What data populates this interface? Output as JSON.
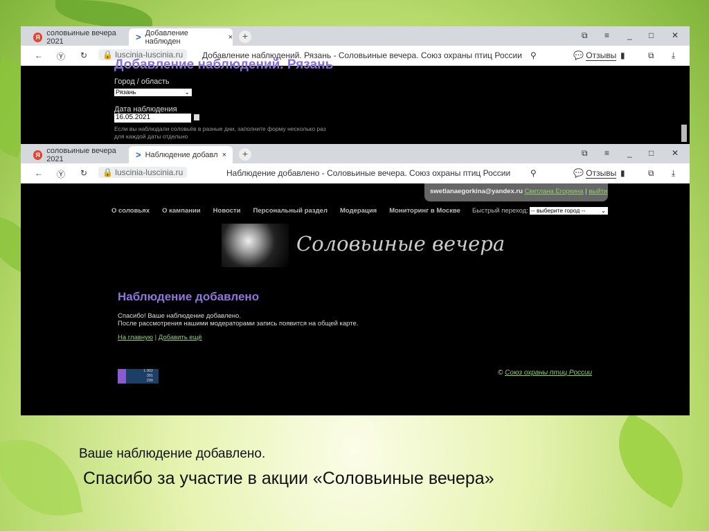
{
  "window1": {
    "tabs": [
      {
        "label": "соловьиные вечера 2021"
      },
      {
        "label": "Добавление наблюден"
      }
    ],
    "url": "luscinia-luscinia.ru",
    "page_title": "Добавление наблюдений. Рязань - Соловьиные вечера. Союз охраны птиц России",
    "reviews_label": "Отзывы",
    "form": {
      "heading": "Добавление наблюдений. Рязань",
      "city_label": "Город / область",
      "city_value": "Рязань",
      "date_label": "Дата наблюдения",
      "date_value": "16.05.2021",
      "hint": "Если вы наблюдали соловьёв в разные дни, заполните форму несколько раз для каждой даты отдельно"
    }
  },
  "window2": {
    "tabs": [
      {
        "label": "соловьиные вечера 2021"
      },
      {
        "label": "Наблюдение добавлено"
      }
    ],
    "url": "luscinia-luscinia.ru",
    "page_title": "Наблюдение добавлено - Соловьиные вечера. Союз охраны птиц России",
    "reviews_label": "Отзывы",
    "user": {
      "email": "swetlanaegorkina@yandex.ru",
      "name": "Светлана Егоркина",
      "logout": "выйти"
    },
    "nav": [
      "О соловьях",
      "О кампании",
      "Новости",
      "Персональный раздел",
      "Модерация",
      "Мониторинг в Москве"
    ],
    "quick_label": "Быстрый переход:",
    "quick_select": "-- выберите город --",
    "site_title": "Соловьиные вечера",
    "heading": "Наблюдение добавлено",
    "message1": "Спасибо! Ваше наблюдение добавлено.",
    "message2": "После рассмотрения нашими модераторами запись появится на общей карте.",
    "link_home": "На главную",
    "link_add": "Добавить ещё",
    "counter": [
      "1 902",
      "391",
      "290"
    ],
    "copyright": "©",
    "copyright_link": "Союз охраны птиц России"
  },
  "captions": {
    "line1": "Ваше наблюдение добавлено.",
    "line2": "Спасибо за участие в акции «Соловьиные вечера»"
  }
}
